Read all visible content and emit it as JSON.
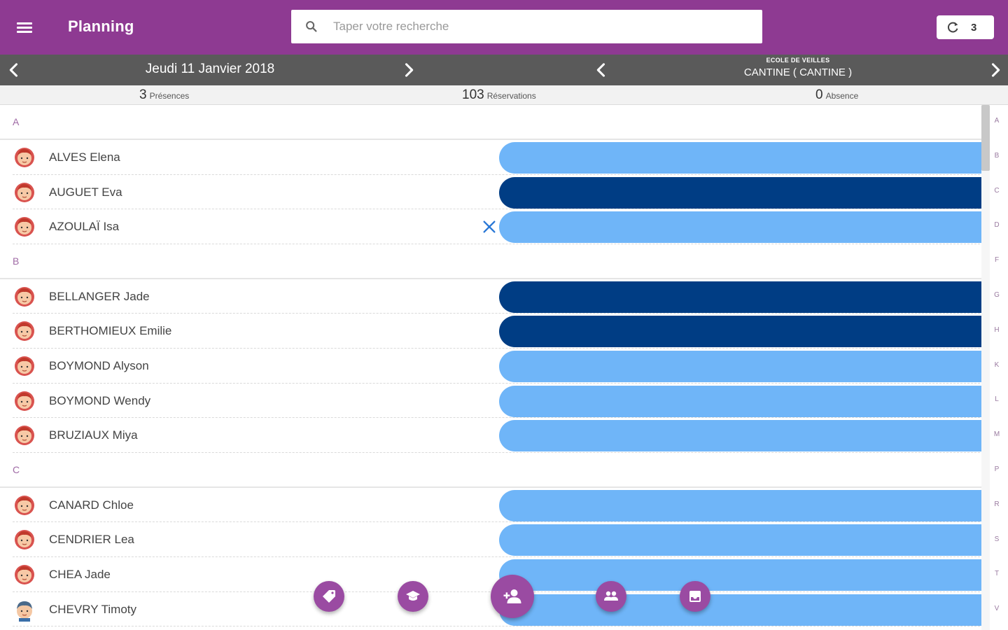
{
  "header": {
    "title": "Planning",
    "search_placeholder": "Taper votre recherche",
    "sync_count": "3"
  },
  "nav": {
    "date": "Jeudi 11 Janvier 2018",
    "place_sub": "ECOLE DE VEILLES",
    "place_main": "CANTINE ( CANTINE )"
  },
  "stats": {
    "presences_count": "3",
    "presences_label": "Présences",
    "reservations_count": "103",
    "reservations_label": "Réservations",
    "absence_count": "0",
    "absence_label": "Absence"
  },
  "colors": {
    "brand": "#8e3a92",
    "nav": "#5a5a5a",
    "bar_light": "#6fb5f8",
    "bar_dark": "#003d84",
    "fab": "#9a4ba2"
  },
  "sections": [
    {
      "letter": "A",
      "children": [
        {
          "name": "ALVES Elena",
          "avatar": "girl",
          "bar": "light",
          "flag": false
        },
        {
          "name": "AUGUET Eva",
          "avatar": "girl",
          "bar": "dark",
          "flag": false
        },
        {
          "name": "AZOULAÏ Isa",
          "avatar": "girl",
          "bar": "light",
          "flag": true
        }
      ]
    },
    {
      "letter": "B",
      "children": [
        {
          "name": "BELLANGER Jade",
          "avatar": "girl",
          "bar": "dark",
          "flag": false
        },
        {
          "name": "BERTHOMIEUX Emilie",
          "avatar": "girl",
          "bar": "dark",
          "flag": false
        },
        {
          "name": "BOYMOND Alyson",
          "avatar": "girl",
          "bar": "light",
          "flag": false
        },
        {
          "name": "BOYMOND Wendy",
          "avatar": "girl",
          "bar": "light",
          "flag": false
        },
        {
          "name": "BRUZIAUX Miya",
          "avatar": "girl",
          "bar": "light",
          "flag": false
        }
      ]
    },
    {
      "letter": "C",
      "children": [
        {
          "name": "CANARD Chloe",
          "avatar": "girl",
          "bar": "light",
          "flag": false
        },
        {
          "name": "CENDRIER Lea",
          "avatar": "girl",
          "bar": "light",
          "flag": false
        },
        {
          "name": "CHEA Jade",
          "avatar": "girl",
          "bar": "light",
          "flag": false
        },
        {
          "name": "CHEVRY Timoty",
          "avatar": "boy",
          "bar": "light",
          "flag": false
        }
      ]
    }
  ],
  "alphabet_index": [
    "A",
    "B",
    "C",
    "D",
    "F",
    "G",
    "H",
    "K",
    "L",
    "M",
    "P",
    "R",
    "S",
    "T",
    "V"
  ],
  "fabs": [
    {
      "name": "tag-fab",
      "icon": "tag-icon"
    },
    {
      "name": "school-fab",
      "icon": "school-icon"
    },
    {
      "name": "add-person-fab",
      "icon": "person-add-icon"
    },
    {
      "name": "group-fab",
      "icon": "group-icon"
    },
    {
      "name": "inbox-fab",
      "icon": "inbox-icon"
    }
  ]
}
